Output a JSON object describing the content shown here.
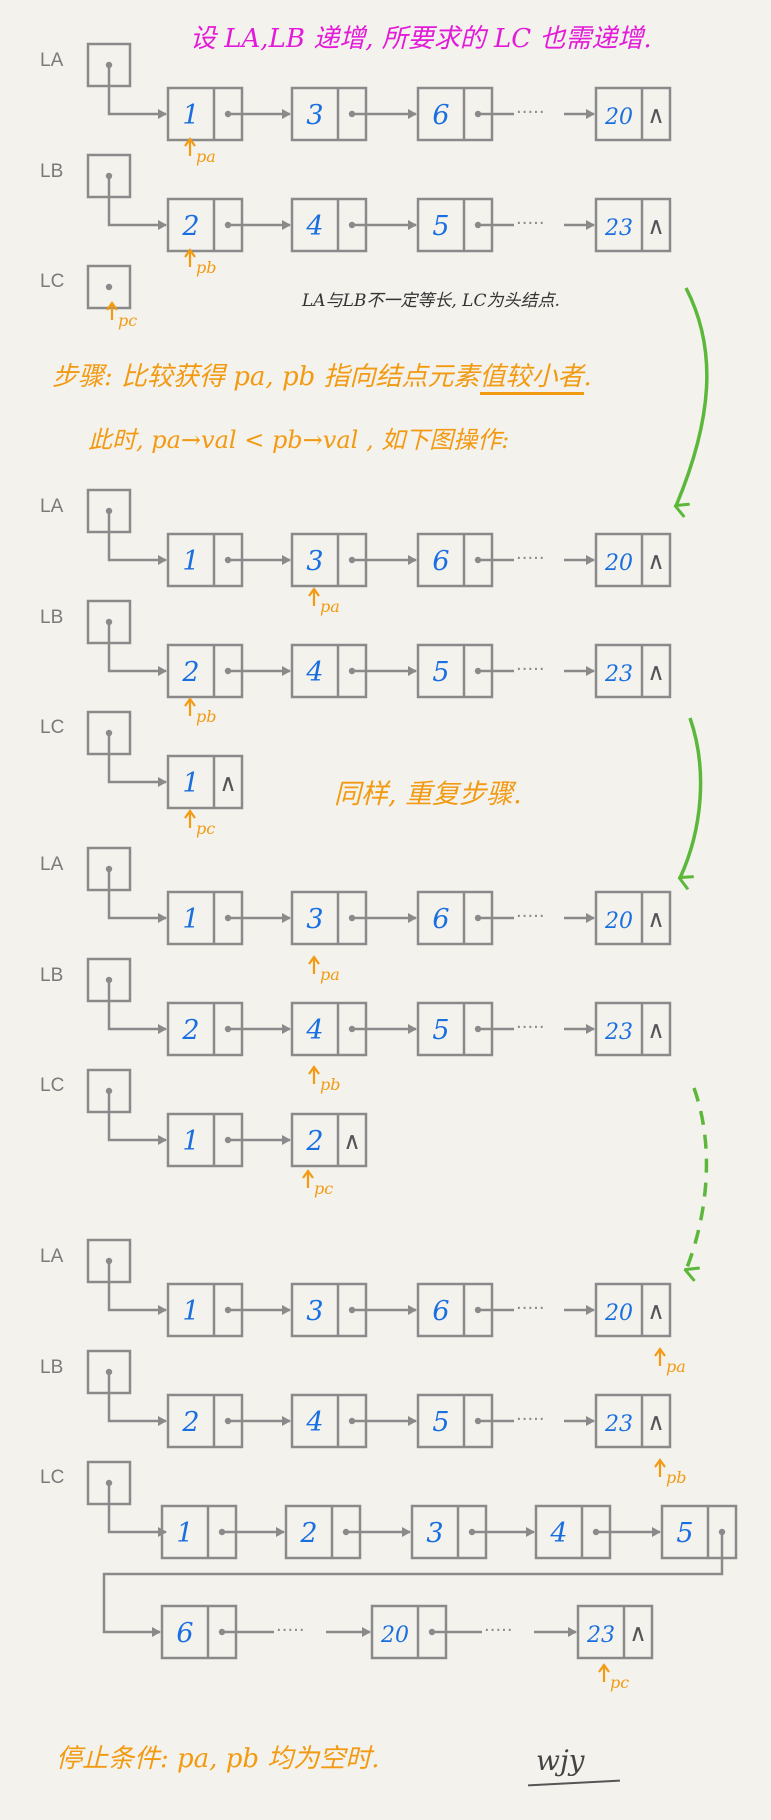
{
  "texts": {
    "title": "设 LA,LB 递增, 所要求的 LC 也需递增.",
    "note": "LA与LB不一定等长, LC为头结点.",
    "step_a": "步骤: 比较获得 pa, pb 指向结点元素",
    "step_b": "值较小者",
    "step_c": ".",
    "step2": "此时,  pa→val  <  pb→val , 如下图操作:",
    "repeat": "同样, 重复步骤.",
    "stop": "停止条件:  pa, pb 均为空时.",
    "signature": "wjy"
  },
  "labels": {
    "la": "LA",
    "lb": "LB",
    "lc": "LC",
    "pa": "pa",
    "pb": "pb",
    "pc": "pc"
  },
  "dots": "·····",
  "null_symbol": "∧",
  "stages": [
    {
      "la": [
        "1",
        "3",
        "6",
        "20"
      ],
      "lb": [
        "2",
        "4",
        "5",
        "23"
      ],
      "lc": [],
      "pa": "la.0",
      "pb": "lb.0",
      "pc": "lc.head"
    },
    {
      "la": [
        "1",
        "3",
        "6",
        "20"
      ],
      "lb": [
        "2",
        "4",
        "5",
        "23"
      ],
      "lc": [
        "1"
      ],
      "pa": "la.1",
      "pb": "lb.0",
      "pc": "lc.0"
    },
    {
      "la": [
        "1",
        "3",
        "6",
        "20"
      ],
      "lb": [
        "2",
        "4",
        "5",
        "23"
      ],
      "lc": [
        "1",
        "2"
      ],
      "pa": "la.1",
      "pb": "lb.1",
      "pc": "lc.1"
    },
    {
      "la": [
        "1",
        "3",
        "6",
        "20"
      ],
      "lb": [
        "2",
        "4",
        "5",
        "23"
      ],
      "lc": [
        "1",
        "2",
        "3",
        "4",
        "5",
        "6",
        "20",
        "23"
      ],
      "pa": "la.null",
      "pb": "lb.null",
      "pc": "lc.last"
    }
  ],
  "colors": {
    "box": "#8a8a8a",
    "value": "#1a6fe0",
    "pointer": "#f29a12",
    "title": "#e21bd8",
    "transition_arrow": "#5cb83a",
    "label": "#7a7a7a"
  }
}
